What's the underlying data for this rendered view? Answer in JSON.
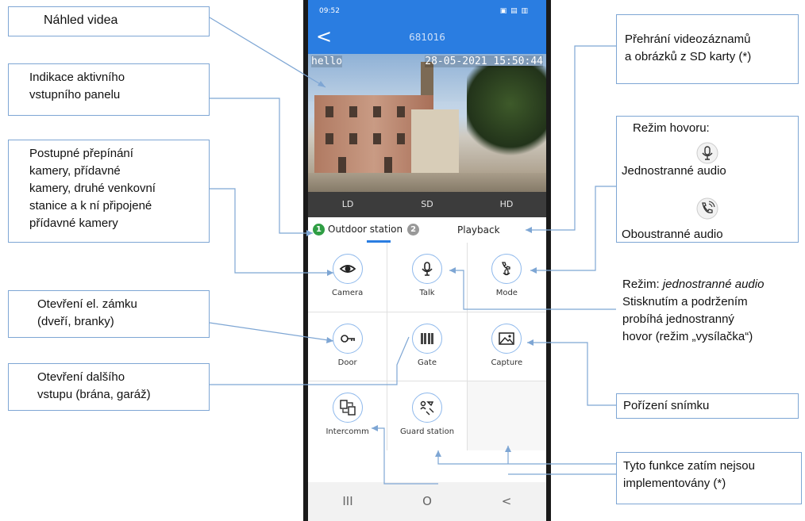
{
  "phone": {
    "status_time": "09:52",
    "title": "681016",
    "back": "<",
    "osd_left": "hello",
    "osd_right": "28-05-2021 15:50:44",
    "quality": [
      "LD",
      "SD",
      "HD"
    ],
    "tab_outdoor": "Outdoor station",
    "tab_outdoor_badge": "1",
    "tab_second_badge": "2",
    "tab_playback": "Playback",
    "tiles": [
      {
        "label": "Camera",
        "icon": "eye-icon"
      },
      {
        "label": "Talk",
        "icon": "microphone-icon"
      },
      {
        "label": "Mode",
        "icon": "phone-mic-icon"
      },
      {
        "label": "Door",
        "icon": "key-icon"
      },
      {
        "label": "Gate",
        "icon": "gate-icon"
      },
      {
        "label": "Capture",
        "icon": "image-icon"
      },
      {
        "label": "Intercomm",
        "icon": "intercom-icon"
      },
      {
        "label": "Guard station",
        "icon": "guard-icon"
      },
      {
        "label": "",
        "icon": ""
      }
    ],
    "nav": [
      "III",
      "O",
      "<"
    ]
  },
  "callouts": {
    "nahled": "Náhled videa",
    "indikace": [
      "Indikace aktivního",
      "vstupního panelu"
    ],
    "postupne": [
      "Postupné přepínání",
      "kamery, přídavné",
      "kamery, druhé venkovní",
      "stanice a k ní připojené",
      "přídavné kamery"
    ],
    "zamek": [
      "Otevření el. zámku",
      "(dveří, branky)"
    ],
    "dalsi": [
      "Otevření dalšího",
      "vstupu (brána, garáž)"
    ],
    "prehrani": [
      "Přehrání videozáznamů",
      "a obrázků z SD karty (*)"
    ],
    "rezim_hovoru": {
      "title": "Režim hovoru:",
      "one_way": "Jednostranné audio",
      "two_way": "Oboustranné audio"
    },
    "rezim_jedno": {
      "prefix": "Režim: ",
      "italic": "jednostranné audio",
      "lines": [
        "Stisknutím a podržením",
        "probíhá jednostranný",
        "hovor (režim „vysílačka“)"
      ]
    },
    "porizeni": "Pořízení snímku",
    "nefunkce": [
      "Tyto funkce zatím nejsou",
      "implementovány (*)"
    ]
  },
  "colors": {
    "accent": "#2a7de1",
    "line": "#7ea6d4"
  }
}
